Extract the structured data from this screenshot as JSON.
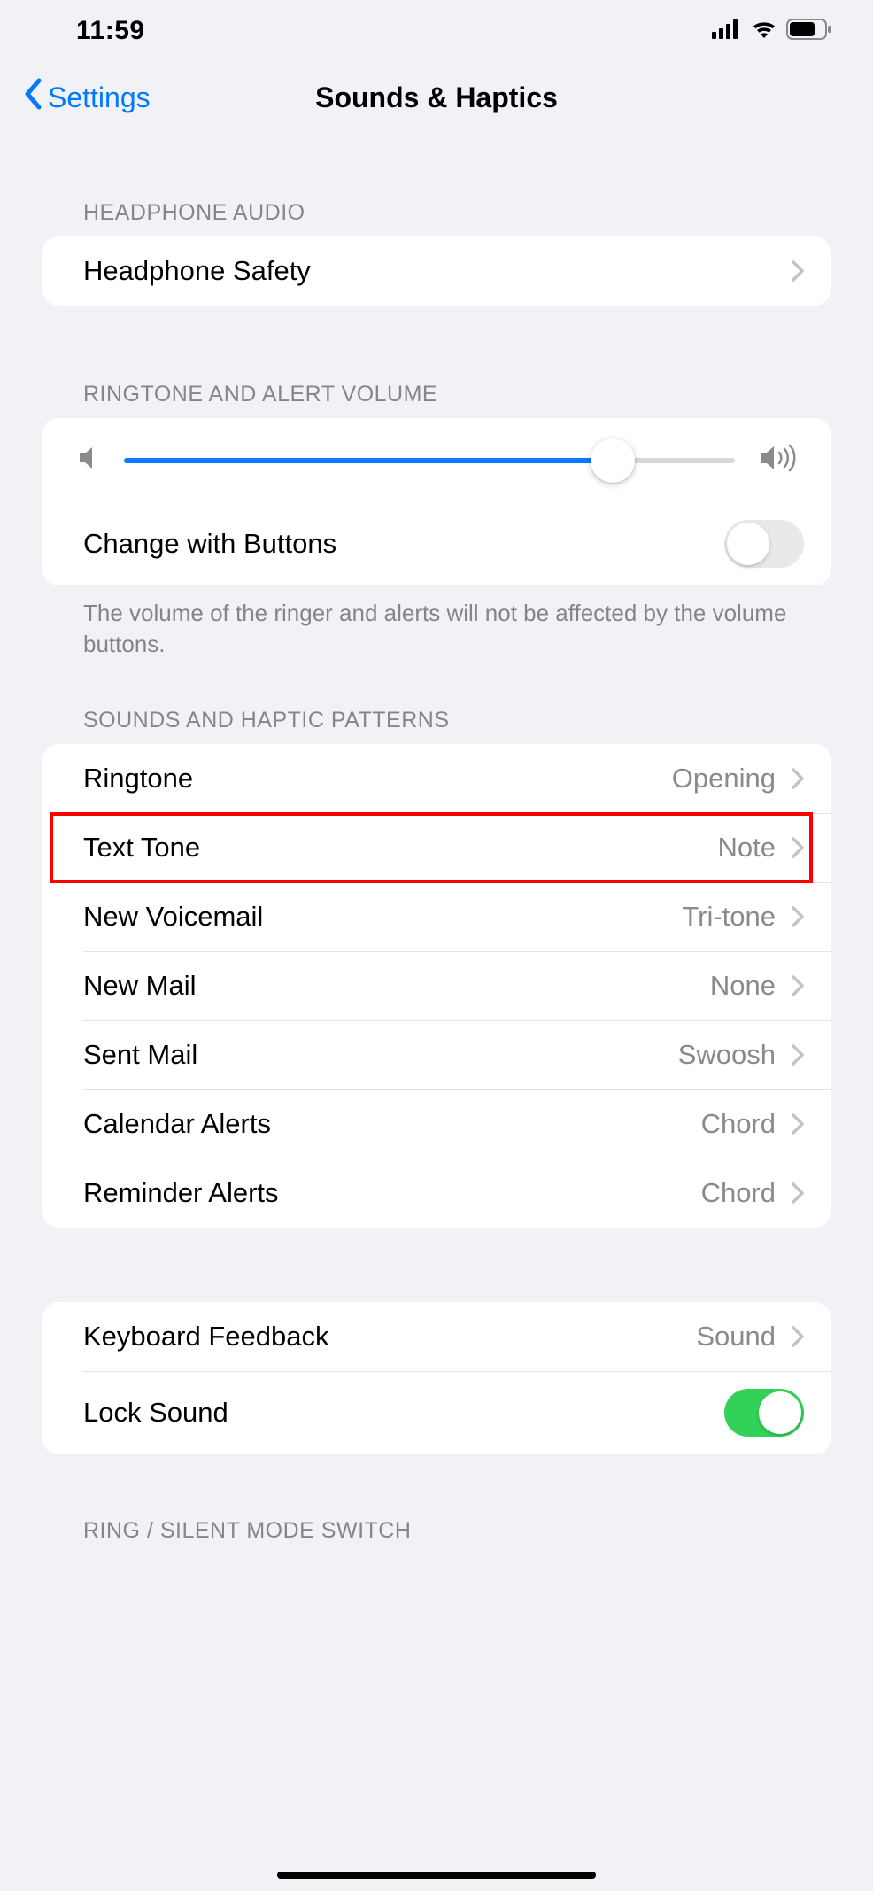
{
  "status": {
    "time": "11:59"
  },
  "nav": {
    "back_label": "Settings",
    "title": "Sounds & Haptics"
  },
  "sections": {
    "headphone": {
      "header": "HEADPHONE AUDIO",
      "safety_label": "Headphone Safety"
    },
    "volume": {
      "header": "RINGTONE AND ALERT VOLUME",
      "slider_percent": 80,
      "change_buttons_label": "Change with Buttons",
      "change_buttons_on": false,
      "footer": "The volume of the ringer and alerts will not be affected by the volume buttons."
    },
    "patterns": {
      "header": "SOUNDS AND HAPTIC PATTERNS",
      "items": [
        {
          "label": "Ringtone",
          "value": "Opening"
        },
        {
          "label": "Text Tone",
          "value": "Note"
        },
        {
          "label": "New Voicemail",
          "value": "Tri-tone"
        },
        {
          "label": "New Mail",
          "value": "None"
        },
        {
          "label": "Sent Mail",
          "value": "Swoosh"
        },
        {
          "label": "Calendar Alerts",
          "value": "Chord"
        },
        {
          "label": "Reminder Alerts",
          "value": "Chord"
        }
      ]
    },
    "feedback": {
      "keyboard_label": "Keyboard Feedback",
      "keyboard_value": "Sound",
      "lock_label": "Lock Sound",
      "lock_on": true
    },
    "ring_silent": {
      "header": "RING / SILENT MODE SWITCH"
    }
  },
  "highlight": {
    "target": "text-tone-row"
  }
}
